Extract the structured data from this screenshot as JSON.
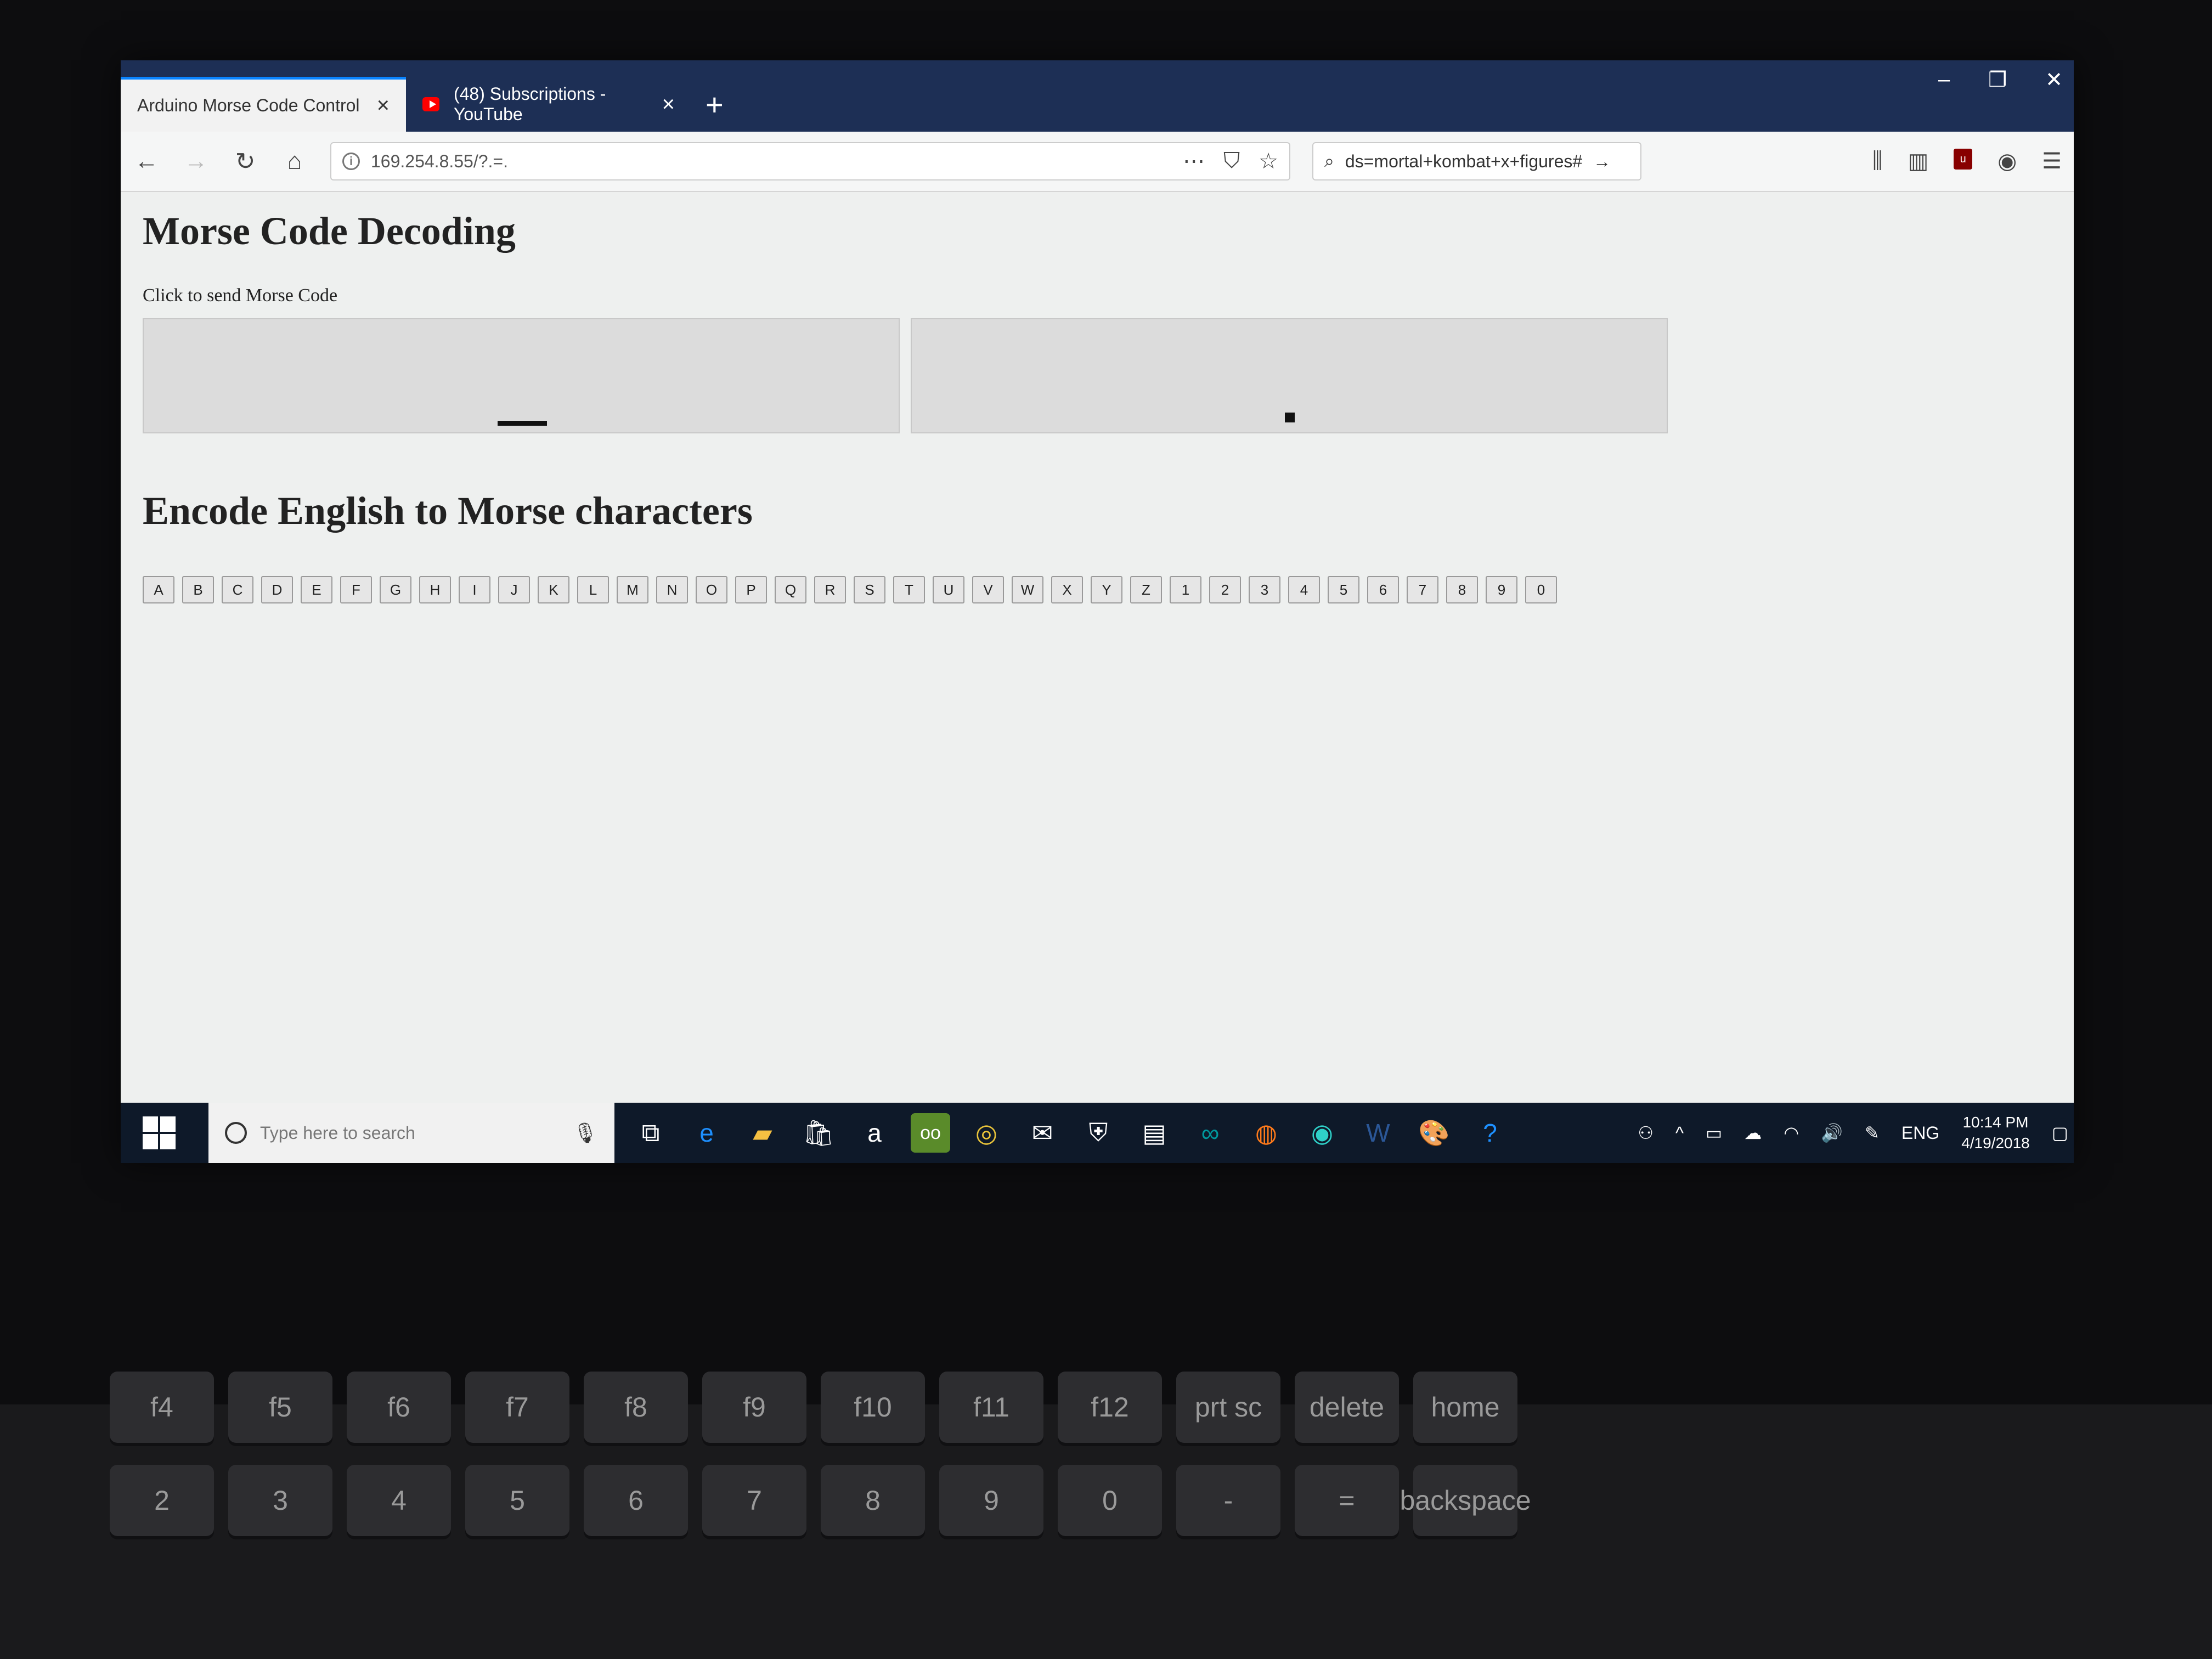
{
  "browser": {
    "tabs": [
      {
        "label": "Arduino Morse Code Control",
        "active": true
      },
      {
        "label": "(48) Subscriptions - YouTube",
        "active": false,
        "icon": "youtube-icon"
      }
    ],
    "url": "169.254.8.55/?.=.",
    "search": "ds=mortal+kombat+x+figures#"
  },
  "page": {
    "title": "Morse Code Decoding",
    "subtitle": "Click to send Morse Code",
    "encode_heading": "Encode English to Morse characters",
    "keys": [
      "A",
      "B",
      "C",
      "D",
      "E",
      "F",
      "G",
      "H",
      "I",
      "J",
      "K",
      "L",
      "M",
      "N",
      "O",
      "P",
      "Q",
      "R",
      "S",
      "T",
      "U",
      "V",
      "W",
      "X",
      "Y",
      "Z",
      "1",
      "2",
      "3",
      "4",
      "5",
      "6",
      "7",
      "8",
      "9",
      "0"
    ]
  },
  "taskbar": {
    "search_placeholder": "Type here to search",
    "language": "ENG",
    "time": "10:14 PM",
    "date": "4/19/2018"
  },
  "keyboard": {
    "number_row": [
      "2",
      "3",
      "4",
      "5",
      "6",
      "7",
      "8",
      "9",
      "0",
      "-",
      "=",
      "backspace"
    ],
    "function_row": [
      "f4",
      "f5",
      "f6",
      "f7",
      "f8",
      "f9",
      "f10",
      "f11",
      "f12",
      "prt sc",
      "delete",
      "home"
    ]
  }
}
